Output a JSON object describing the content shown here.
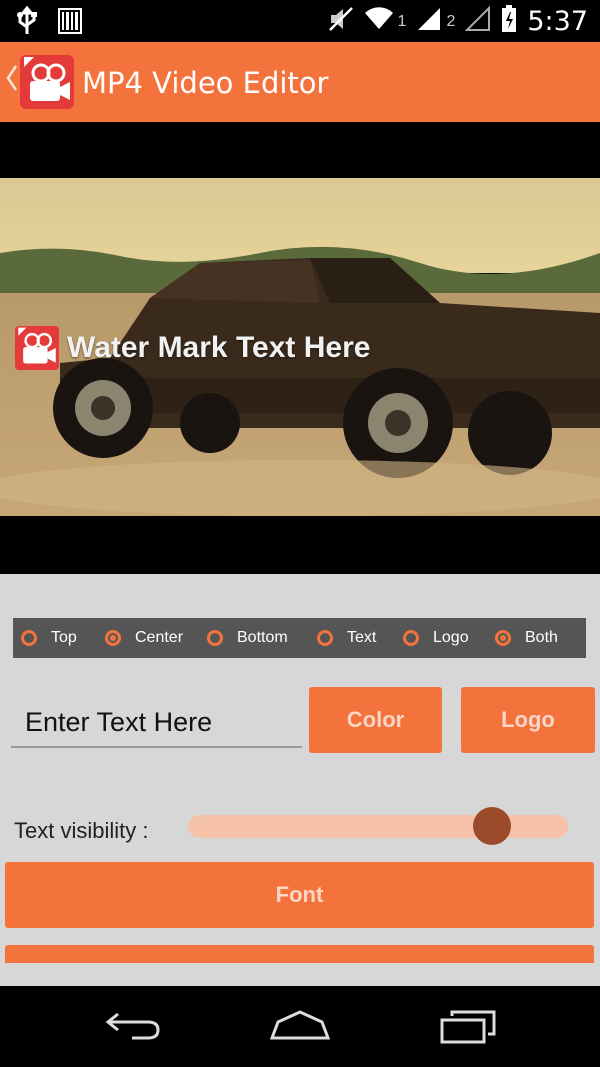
{
  "status_bar": {
    "icons": [
      "usb-icon",
      "barcode-icon",
      "mute-icon",
      "wifi-icon",
      "signal-icon",
      "signal-icon",
      "battery-icon"
    ],
    "sim1_label": "1",
    "sim2_label": "2",
    "time": "5:37"
  },
  "app_bar": {
    "back_icon": "chevron-left-icon",
    "logo_icon": "video-camera-icon",
    "title": "MP4 Video Editor"
  },
  "video": {
    "watermark_icon": "video-camera-icon",
    "watermark_text": "Water Mark Text Here"
  },
  "position_options": [
    {
      "label": "Top",
      "checked": false
    },
    {
      "label": "Center",
      "checked": true
    },
    {
      "label": "Bottom",
      "checked": false
    },
    {
      "label": "Text",
      "checked": false
    },
    {
      "label": "Logo",
      "checked": false
    },
    {
      "label": "Both",
      "checked": true
    }
  ],
  "text_input": {
    "value": "Enter Text Here"
  },
  "buttons": {
    "color_label": "Color",
    "logo_label": "Logo",
    "font_label": "Font"
  },
  "visibility": {
    "label": "Text visibility :",
    "value_fraction": 0.8
  },
  "colors": {
    "accent": "#f4733d",
    "button_text": "#fbd6c6",
    "slider_track": "#f6c3aa",
    "slider_thumb": "#9b4a2a",
    "panel_bg": "#d7d7d7",
    "option_bar_bg": "#555555"
  },
  "nav_bar": {
    "icons": [
      "back-icon",
      "home-icon",
      "recents-icon"
    ]
  }
}
